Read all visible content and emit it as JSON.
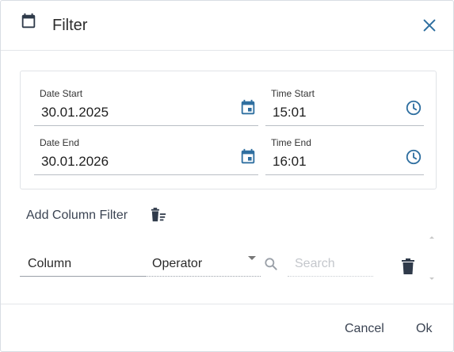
{
  "dialog": {
    "title": "Filter",
    "header_icon": "calendar-icon",
    "close_icon": "close-icon"
  },
  "colors": {
    "accent": "#2f6fa0",
    "icon_dark": "#2f3a4a",
    "border": "#e0e3e7"
  },
  "date_range": {
    "date_start": {
      "label": "Date Start",
      "value": "30.01.2025",
      "icon": "calendar-icon"
    },
    "time_start": {
      "label": "Time Start",
      "value": "15:01",
      "icon": "clock-icon"
    },
    "date_end": {
      "label": "Date End",
      "value": "30.01.2026",
      "icon": "calendar-icon"
    },
    "time_end": {
      "label": "Time End",
      "value": "16:01",
      "icon": "clock-icon"
    }
  },
  "column_filter": {
    "add_label": "Add Column Filter",
    "clear_icon": "clear-filters-icon",
    "rows": [
      {
        "column": "Column",
        "operator": "Operator",
        "search_placeholder": "Search",
        "search_value": "",
        "delete_icon": "trash-icon"
      }
    ]
  },
  "footer": {
    "cancel_label": "Cancel",
    "ok_label": "Ok"
  }
}
